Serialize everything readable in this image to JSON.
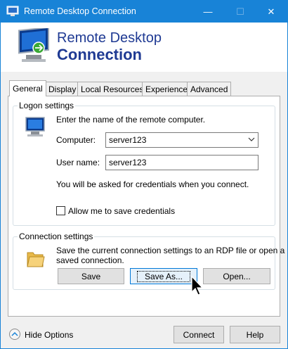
{
  "window": {
    "title": "Remote Desktop Connection",
    "controls": {
      "minimize": "—",
      "maximize": "☐",
      "close": "✕"
    }
  },
  "banner": {
    "line1": "Remote Desktop",
    "line2": "Connection"
  },
  "tabs": [
    {
      "label": "General",
      "active": true
    },
    {
      "label": "Display",
      "active": false
    },
    {
      "label": "Local Resources",
      "active": false
    },
    {
      "label": "Experience",
      "active": false
    },
    {
      "label": "Advanced",
      "active": false
    }
  ],
  "logon": {
    "legend": "Logon settings",
    "instruction": "Enter the name of the remote computer.",
    "computer_label": "Computer:",
    "computer_value": "server123",
    "username_label": "User name:",
    "username_value": "server123",
    "credentials_note": "You will be asked for credentials when you connect.",
    "save_credentials_label": "Allow me to save credentials",
    "save_credentials_checked": false
  },
  "connection": {
    "legend": "Connection settings",
    "description_line1": "Save the current connection settings to an RDP file or open a",
    "description_line2": "saved connection.",
    "save_label": "Save",
    "save_as_label": "Save As...",
    "open_label": "Open..."
  },
  "footer": {
    "hide_options_label": "Hide Options",
    "connect_label": "Connect",
    "help_label": "Help"
  },
  "icons": [
    "rdp-app-icon",
    "monitor-icon",
    "folder-icon",
    "chevron-up-icon",
    "mouse-cursor-icon"
  ],
  "colors": {
    "titlebar": "#1883d7",
    "banner_text": "#1f3a93",
    "focus_border": "#0078d7"
  }
}
